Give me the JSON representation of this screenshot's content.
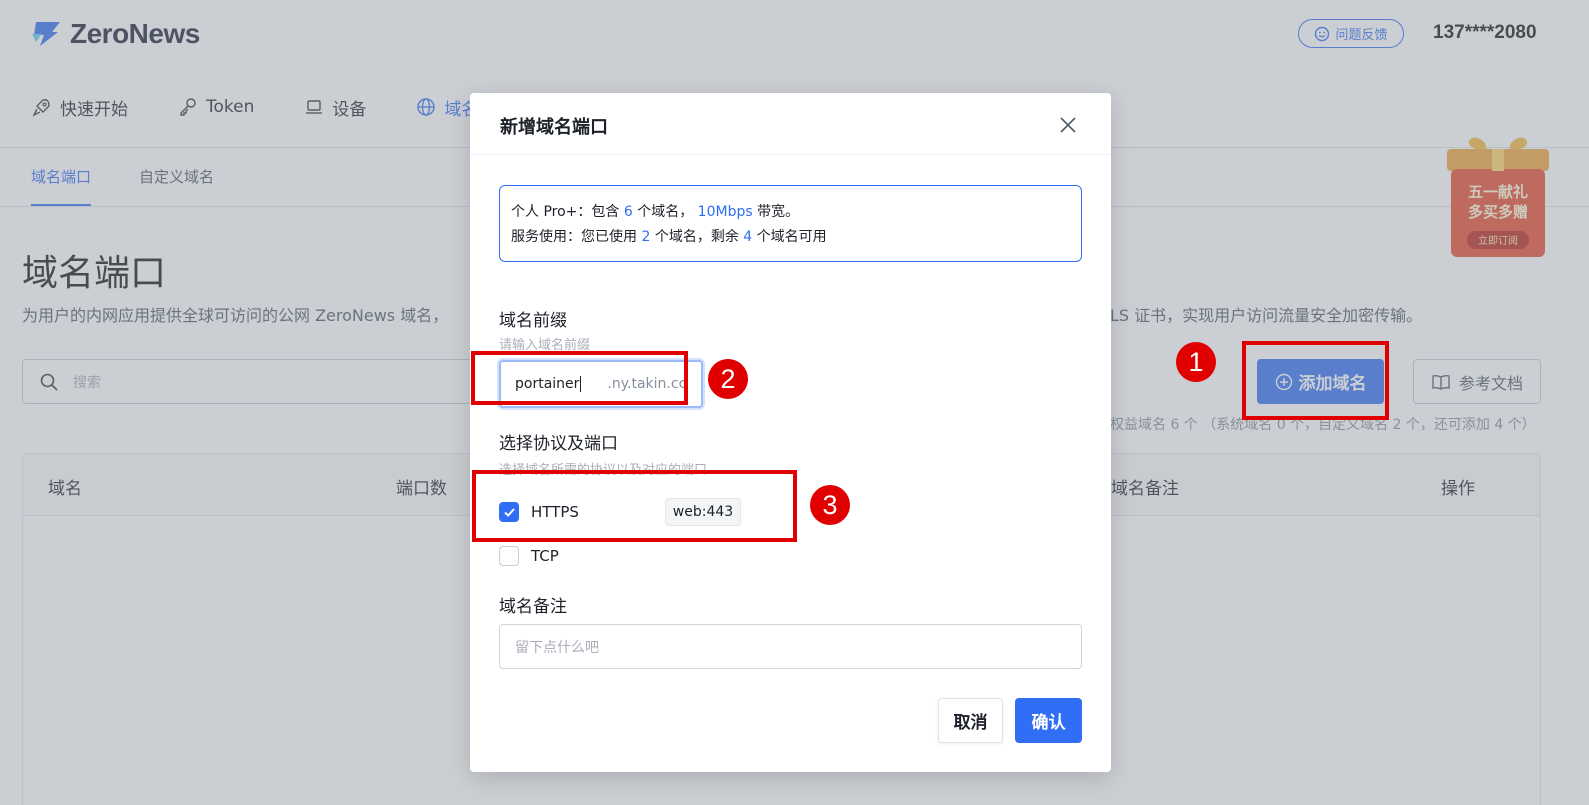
{
  "header": {
    "logo_text": "ZeroNews",
    "feedback_label": "问题反馈",
    "user_phone": "137****2080"
  },
  "nav": {
    "items": [
      {
        "label": "快速开始",
        "icon": "rocket-icon"
      },
      {
        "label": "Token",
        "icon": "key-icon"
      },
      {
        "label": "设备",
        "icon": "laptop-icon"
      },
      {
        "label": "域名",
        "icon": "globe-icon",
        "active": true
      }
    ]
  },
  "subtabs": [
    {
      "label": "域名端口",
      "active": true
    },
    {
      "label": "自定义域名",
      "active": false
    }
  ],
  "page": {
    "title": "域名端口",
    "desc_left": "为用户的内网应用提供全球可访问的公网 ZeroNews 域名，",
    "desc_right": "LS 证书，实现用户访问流量安全加密传输。",
    "search_placeholder": "搜索",
    "add_button": "添加域名",
    "docs_button": "参考文档",
    "quota_text": "权益域名 6 个 （系统域名 0 个，自定义域名 2 个，还可添加 4 个）"
  },
  "table": {
    "columns": [
      "域名",
      "端口数",
      "域名备注",
      "操作"
    ]
  },
  "promo": {
    "line1": "五一献礼",
    "line2": "多买多赠",
    "cta": "立即订阅"
  },
  "modal": {
    "title": "新增域名端口",
    "info": {
      "line1_pre": "个人 Pro+：包含 ",
      "line1_count": "6",
      "line1_mid": " 个域名，  ",
      "line1_bw": "10Mbps",
      "line1_post": " 带宽。",
      "line2_pre": "服务使用：您已使用 ",
      "line2_used": "2",
      "line2_mid": " 个域名，剩余 ",
      "line2_left": "4",
      "line2_post": " 个域名可用"
    },
    "prefix_label": "域名前缀",
    "prefix_hint": "请输入域名前缀",
    "prefix_value": "portainer",
    "prefix_suffix": ".ny.takin.cc",
    "protocol_label": "选择协议及端口",
    "protocol_hint": "选择域名所需的协议以及对应的端口",
    "protocols": [
      {
        "name": "HTTPS",
        "checked": true,
        "port_tag": "web:443"
      },
      {
        "name": "TCP",
        "checked": false
      }
    ],
    "note_label": "域名备注",
    "note_placeholder": "留下点什么吧",
    "cancel_label": "取消",
    "confirm_label": "确认"
  },
  "annotations": {
    "marker1": "1",
    "marker2": "2",
    "marker3": "3",
    "color": "#e00000"
  },
  "colors": {
    "primary": "#2f6ef5",
    "danger_annotation": "#e00000"
  }
}
